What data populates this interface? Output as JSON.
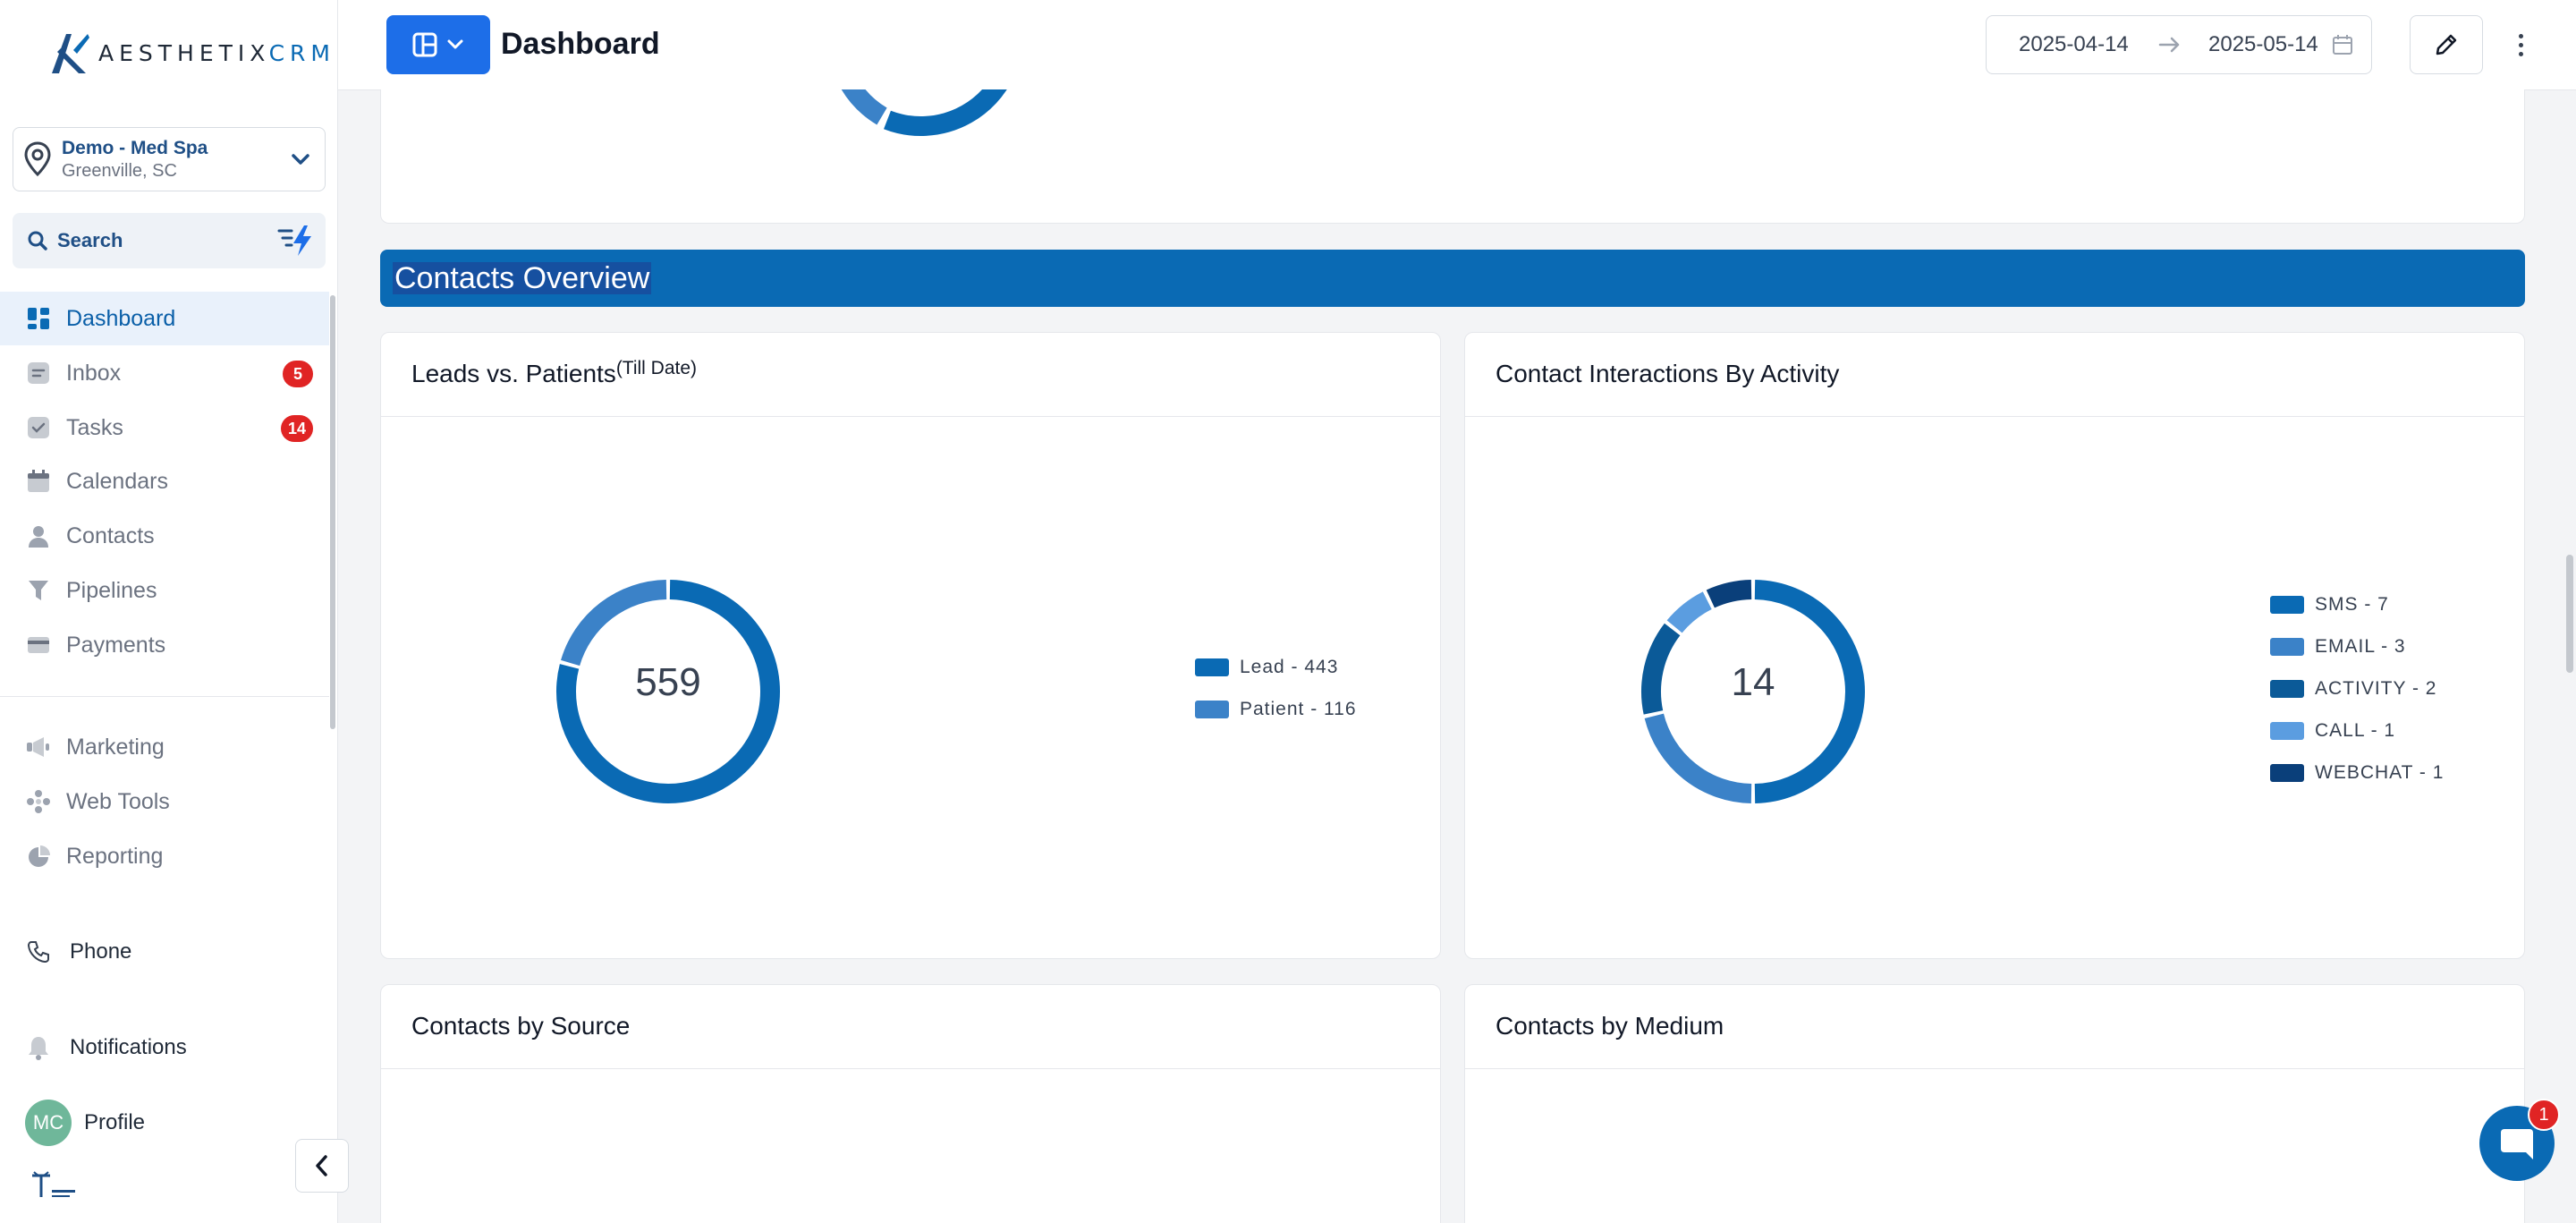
{
  "brand": {
    "name_part1": "AESTHETIX",
    "name_part2": "CRM"
  },
  "location": {
    "name": "Demo - Med Spa",
    "city": "Greenville, SC"
  },
  "search": {
    "label": "Search"
  },
  "nav": {
    "items": [
      {
        "label": "Dashboard",
        "icon": "dashboard-icon",
        "active": true
      },
      {
        "label": "Inbox",
        "icon": "inbox-icon",
        "badge": "5"
      },
      {
        "label": "Tasks",
        "icon": "tasks-icon",
        "badge": "14"
      },
      {
        "label": "Calendars",
        "icon": "calendar-icon"
      },
      {
        "label": "Contacts",
        "icon": "contacts-icon"
      },
      {
        "label": "Pipelines",
        "icon": "pipelines-icon"
      },
      {
        "label": "Payments",
        "icon": "payments-icon"
      },
      {
        "label": "Marketing",
        "icon": "marketing-icon"
      },
      {
        "label": "Web Tools",
        "icon": "web-tools-icon"
      },
      {
        "label": "Reporting",
        "icon": "reporting-icon"
      }
    ],
    "phone": "Phone",
    "notifications": "Notifications",
    "profile": "Profile",
    "avatar_initials": "MC"
  },
  "header": {
    "title": "Dashboard",
    "date_start": "2025-04-14",
    "date_end": "2025-05-14"
  },
  "section": {
    "title": "Contacts Overview"
  },
  "cards": {
    "leads": {
      "title": "Leads vs. Patients",
      "subtitle": "(Till Date)",
      "center": "559"
    },
    "interactions": {
      "title": "Contact Interactions By Activity",
      "center": "14"
    },
    "source": {
      "title": "Contacts by Source"
    },
    "medium": {
      "title": "Contacts by Medium"
    }
  },
  "chat": {
    "badge": "1"
  },
  "colors": {
    "primary": "#0a6ab4",
    "secondary": "#3b82c8",
    "dark": "#0b5a98",
    "light": "#5b9de0",
    "navy": "#0a3f7a",
    "badge_red": "#e02424"
  },
  "chart_data": [
    {
      "type": "pie",
      "title": "Leads vs. Patients",
      "center_label": "559",
      "series": [
        {
          "name": "Lead",
          "value": 443,
          "color": "#0a6ab4"
        },
        {
          "name": "Patient",
          "value": 116,
          "color": "#3b82c8"
        }
      ],
      "legend": [
        "Lead - 443",
        "Patient - 116"
      ],
      "legend_position": "right"
    },
    {
      "type": "pie",
      "title": "Contact Interactions By Activity",
      "center_label": "14",
      "series": [
        {
          "name": "SMS",
          "value": 7,
          "color": "#0a6ab4"
        },
        {
          "name": "EMAIL",
          "value": 3,
          "color": "#3b82c8"
        },
        {
          "name": "ACTIVITY",
          "value": 2,
          "color": "#0b5a98"
        },
        {
          "name": "CALL",
          "value": 1,
          "color": "#5b9de0"
        },
        {
          "name": "WEBCHAT",
          "value": 1,
          "color": "#0a3f7a"
        }
      ],
      "legend": [
        "SMS - 7",
        "EMAIL - 3",
        "ACTIVITY - 2",
        "CALL - 1",
        "WEBCHAT - 1"
      ],
      "legend_position": "right"
    }
  ]
}
